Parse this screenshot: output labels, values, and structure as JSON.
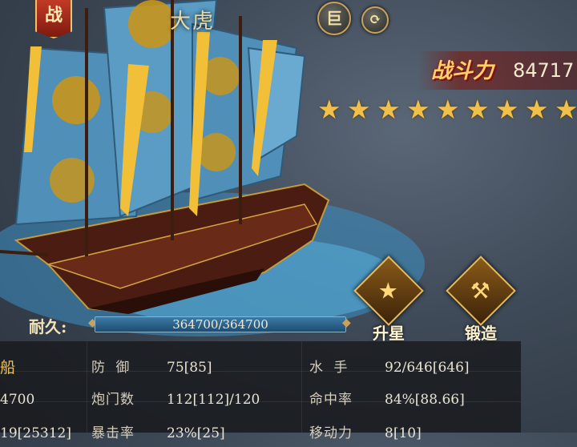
{
  "header": {
    "badge": "战",
    "ship_name": "大虎",
    "ju_button": "巨",
    "swap_icon": "swap-icon"
  },
  "power": {
    "label": "战斗力",
    "value": "84717"
  },
  "stars": {
    "count": 9,
    "icon": "star-icon"
  },
  "durability": {
    "label": "耐久:",
    "text": "364700/364700",
    "fraction": 1.0
  },
  "actions": [
    {
      "label": "升星",
      "icon": "star-upgrade-icon"
    },
    {
      "label": "锻造",
      "icon": "anvil-forge-icon"
    }
  ],
  "stats": {
    "left_partial": [
      "船",
      "4700",
      "19[25312]"
    ],
    "middle": [
      {
        "label": "防 御",
        "value": "75[85]"
      },
      {
        "label": "炮门数",
        "value": "112[112]/120"
      },
      {
        "label": "暴击率",
        "value": "23%[25]"
      }
    ],
    "right": [
      {
        "label": "水 手",
        "value": "92/646[646]"
      },
      {
        "label": "命中率",
        "value": "84%[88.66]"
      },
      {
        "label": "移动力",
        "value": "8[10]"
      }
    ]
  }
}
